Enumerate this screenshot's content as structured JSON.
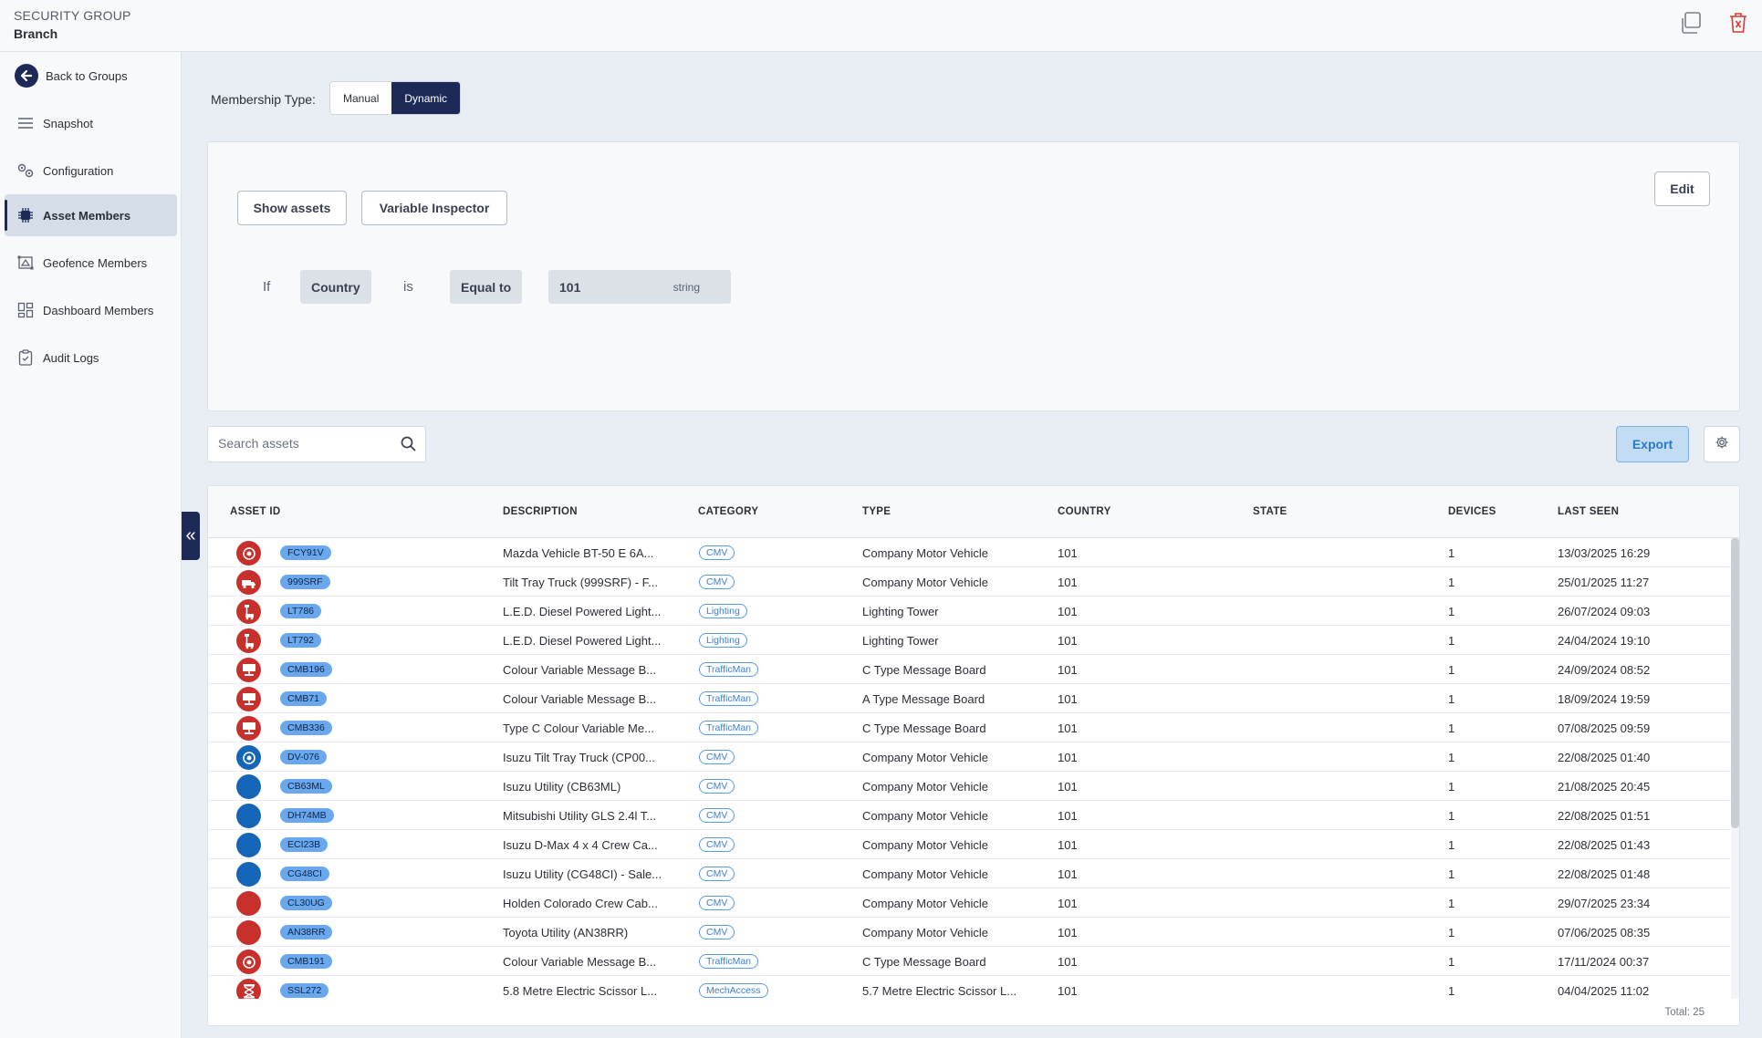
{
  "header": {
    "eyebrow": "SECURITY GROUP",
    "title": "Branch"
  },
  "sidebar": {
    "items": [
      {
        "label": "Back to Groups",
        "icon": "back-arrow-icon"
      },
      {
        "label": "Snapshot",
        "icon": "menu-lines-icon"
      },
      {
        "label": "Configuration",
        "icon": "gears-icon"
      },
      {
        "label": "Asset Members",
        "icon": "chip-icon",
        "active": true
      },
      {
        "label": "Geofence Members",
        "icon": "geofence-icon"
      },
      {
        "label": "Dashboard Members",
        "icon": "dashboard-icon"
      },
      {
        "label": "Audit Logs",
        "icon": "clipboard-icon"
      }
    ]
  },
  "membership": {
    "label": "Membership Type:",
    "options": [
      "Manual",
      "Dynamic"
    ],
    "selected": "Dynamic"
  },
  "rule": {
    "show_assets": "Show assets",
    "variable_inspector": "Variable Inspector",
    "edit": "Edit",
    "if_text": "If",
    "field": "Country",
    "is_text": "is",
    "operator": "Equal to",
    "value": "101",
    "value_type": "string"
  },
  "search": {
    "placeholder": "Search assets"
  },
  "actions": {
    "export": "Export"
  },
  "colors": {
    "accent": "#1d2a57",
    "red": "#c8302c",
    "blue": "#1565b8",
    "pill": "#6aa8ee"
  },
  "table": {
    "columns": [
      "ASSET ID",
      "DESCRIPTION",
      "CATEGORY",
      "TYPE",
      "COUNTRY",
      "STATE",
      "DEVICES",
      "LAST SEEN"
    ],
    "rows": [
      {
        "color": "red",
        "icon": "target-icon",
        "id": "FCY91V",
        "description": "Mazda Vehicle BT-50 E 6A...",
        "category": "CMV",
        "type": "Company Motor Vehicle",
        "country": "101",
        "state": "",
        "devices": "1",
        "last_seen": "13/03/2025 16:29"
      },
      {
        "color": "red",
        "icon": "truck-icon",
        "id": "999SRF",
        "description": "Tilt Tray Truck (999SRF) - F...",
        "category": "CMV",
        "type": "Company Motor Vehicle",
        "country": "101",
        "state": "",
        "devices": "1",
        "last_seen": "25/01/2025 11:27"
      },
      {
        "color": "red",
        "icon": "lighting-tower-icon",
        "id": "LT786",
        "description": "L.E.D. Diesel Powered Light...",
        "category": "Lighting",
        "type": "Lighting Tower",
        "country": "101",
        "state": "",
        "devices": "1",
        "last_seen": "26/07/2024 09:03"
      },
      {
        "color": "red",
        "icon": "lighting-tower-icon",
        "id": "LT792",
        "description": "L.E.D. Diesel Powered Light...",
        "category": "Lighting",
        "type": "Lighting Tower",
        "country": "101",
        "state": "",
        "devices": "1",
        "last_seen": "24/04/2024 19:10"
      },
      {
        "color": "red",
        "icon": "message-board-icon",
        "id": "CMB196",
        "description": "Colour Variable Message B...",
        "category": "TrafficMan",
        "type": "C Type Message Board",
        "country": "101",
        "state": "",
        "devices": "1",
        "last_seen": "24/09/2024 08:52"
      },
      {
        "color": "red",
        "icon": "message-board-icon",
        "id": "CMB71",
        "description": "Colour Variable Message B...",
        "category": "TrafficMan",
        "type": "A Type Message Board",
        "country": "101",
        "state": "",
        "devices": "1",
        "last_seen": "18/09/2024 19:59"
      },
      {
        "color": "red",
        "icon": "message-board-icon",
        "id": "CMB336",
        "description": "Type C Colour Variable Me...",
        "category": "TrafficMan",
        "type": "C Type Message Board",
        "country": "101",
        "state": "",
        "devices": "1",
        "last_seen": "07/08/2025 09:59"
      },
      {
        "color": "blue",
        "icon": "target-icon",
        "id": "DV-076",
        "description": "Isuzu Tilt Tray Truck (CP00...",
        "category": "CMV",
        "type": "Company Motor Vehicle",
        "country": "101",
        "state": "",
        "devices": "1",
        "last_seen": "22/08/2025 01:40"
      },
      {
        "color": "blue",
        "icon": "",
        "id": "CB63ML",
        "description": "Isuzu Utility (CB63ML)",
        "category": "CMV",
        "type": "Company Motor Vehicle",
        "country": "101",
        "state": "",
        "devices": "1",
        "last_seen": "21/08/2025 20:45"
      },
      {
        "color": "blue",
        "icon": "",
        "id": "DH74MB",
        "description": "Mitsubishi Utility GLS 2.4l T...",
        "category": "CMV",
        "type": "Company Motor Vehicle",
        "country": "101",
        "state": "",
        "devices": "1",
        "last_seen": "22/08/2025 01:51"
      },
      {
        "color": "blue",
        "icon": "",
        "id": "ECI23B",
        "description": "Isuzu D-Max 4 x 4 Crew Ca...",
        "category": "CMV",
        "type": "Company Motor Vehicle",
        "country": "101",
        "state": "",
        "devices": "1",
        "last_seen": "22/08/2025 01:43"
      },
      {
        "color": "blue",
        "icon": "",
        "id": "CG48CI",
        "description": "Isuzu Utility (CG48CI) - Sale...",
        "category": "CMV",
        "type": "Company Motor Vehicle",
        "country": "101",
        "state": "",
        "devices": "1",
        "last_seen": "22/08/2025 01:48"
      },
      {
        "color": "red",
        "icon": "",
        "id": "CL30UG",
        "description": "Holden Colorado Crew Cab...",
        "category": "CMV",
        "type": "Company Motor Vehicle",
        "country": "101",
        "state": "",
        "devices": "1",
        "last_seen": "29/07/2025 23:34"
      },
      {
        "color": "red",
        "icon": "",
        "id": "AN38RR",
        "description": "Toyota Utility (AN38RR)",
        "category": "CMV",
        "type": "Company Motor Vehicle",
        "country": "101",
        "state": "",
        "devices": "1",
        "last_seen": "07/06/2025 08:35"
      },
      {
        "color": "red",
        "icon": "target-icon",
        "id": "CMB191",
        "description": "Colour Variable Message B...",
        "category": "TrafficMan",
        "type": "C Type Message Board",
        "country": "101",
        "state": "",
        "devices": "1",
        "last_seen": "17/11/2024 00:37"
      },
      {
        "color": "red",
        "icon": "scissor-lift-icon",
        "id": "SSL272",
        "description": "5.8 Metre Electric Scissor L...",
        "category": "MechAccess",
        "type": "5.7 Metre Electric Scissor L...",
        "country": "101",
        "state": "",
        "devices": "1",
        "last_seen": "04/04/2025 11:02"
      }
    ],
    "total": "Total: 25"
  }
}
